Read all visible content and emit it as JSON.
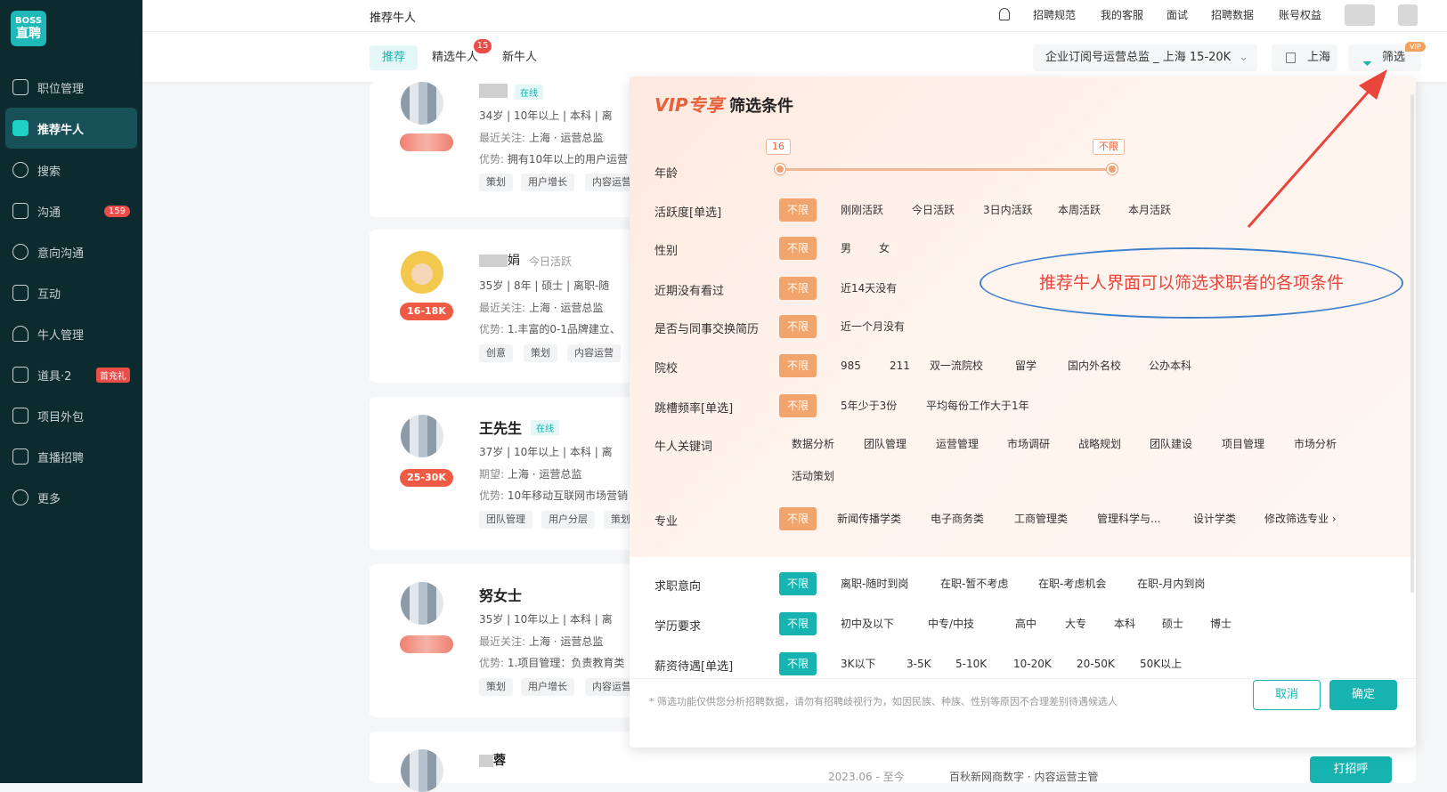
{
  "sidebar": {
    "logo_line1": "BOSS",
    "logo_line2": "直聘",
    "items": [
      {
        "label": "职位管理"
      },
      {
        "label": "推荐牛人"
      },
      {
        "label": "搜索"
      },
      {
        "label": "沟通",
        "badge": "159"
      },
      {
        "label": "意向沟通"
      },
      {
        "label": "互动"
      },
      {
        "label": "牛人管理"
      },
      {
        "label": "道具·2",
        "badge": "首充礼"
      },
      {
        "label": "项目外包"
      },
      {
        "label": "直播招聘"
      },
      {
        "label": "更多"
      }
    ]
  },
  "topbar": {
    "title": "推荐牛人",
    "menu": [
      "招聘规范",
      "我的客服",
      "面试",
      "招聘数据",
      "账号权益"
    ]
  },
  "subbar": {
    "tabs": [
      "推荐",
      "精选牛人",
      "新牛人"
    ],
    "tab_badge": "15",
    "job_select": "企业订阅号运营总监 _ 上海 15-20K",
    "city": "上海",
    "filter": "筛选",
    "vip": "VIP"
  },
  "cards": [
    {
      "active": "在线",
      "row1": [
        "34岁",
        "10年以上",
        "本科",
        "离"
      ],
      "row2_label": "最近关注:",
      "row2": [
        "上海",
        "运营总监"
      ],
      "row3_label": "优势:",
      "row3": "拥有10年以上的用户运营",
      "tags": [
        "策划",
        "用户增长",
        "内容运营"
      ]
    },
    {
      "name_tail": "娟",
      "active": "今日活跃",
      "salary": "16-18K",
      "row1": [
        "35岁",
        "8年",
        "硕士",
        "离职-随"
      ],
      "row2_label": "最近关注:",
      "row2": [
        "上海",
        "运营总监"
      ],
      "row3_label": "优势:",
      "row3": "1.丰富的0-1品牌建立、",
      "tags": [
        "创意",
        "策划",
        "内容运营"
      ]
    },
    {
      "name": "王先生",
      "active": "在线",
      "salary": "25-30K",
      "row1": [
        "37岁",
        "10年以上",
        "本科",
        "离"
      ],
      "row2_label": "期望:",
      "row2": [
        "上海",
        "运营总监"
      ],
      "row3_label": "优势:",
      "row3": "10年移动互联网市场营销",
      "tags": [
        "团队管理",
        "用户分层",
        "策划"
      ]
    },
    {
      "name": "努女士",
      "row1": [
        "35岁",
        "10年以上",
        "本科",
        "离"
      ],
      "row2_label": "最近关注:",
      "row2": [
        "上海",
        "运营总监"
      ],
      "row3_label": "优势:",
      "row3": "1.项目管理：负责教育类",
      "tags": [
        "策划",
        "用户增长",
        "内容运营"
      ]
    },
    {
      "name_tail": "蓉",
      "bottom_text": "2023.06 - 至今",
      "bottom_text2": "百秋新网商数字 · 内容运营主管",
      "greet": "打招呼"
    }
  ],
  "panel": {
    "vip_label": "VIP专享",
    "title": "筛选条件",
    "age_label": "年龄",
    "age_min": "16",
    "age_max": "不限",
    "rows": [
      {
        "label": "活跃度[单选]",
        "selected": "不限",
        "options": [
          "刚刚活跃",
          "今日活跃",
          "3日内活跃",
          "本周活跃",
          "本月活跃"
        ]
      },
      {
        "label": "性别",
        "selected": "不限",
        "options": [
          "男",
          "女"
        ]
      },
      {
        "label": "近期没有看过",
        "selected": "不限",
        "options": [
          "近14天没有"
        ]
      },
      {
        "label": "是否与同事交换简历",
        "selected": "不限",
        "options": [
          "近一个月没有"
        ]
      },
      {
        "label": "院校",
        "selected": "不限",
        "options": [
          "985",
          "211",
          "双一流院校",
          "留学",
          "国内外名校",
          "公办本科"
        ]
      },
      {
        "label": "跳槽频率[单选]",
        "selected": "不限",
        "options": [
          "5年少于3份",
          "平均每份工作大于1年"
        ]
      }
    ],
    "keyword_label": "牛人关键词",
    "keywords": [
      "数据分析",
      "团队管理",
      "运营管理",
      "市场调研",
      "战略规划",
      "团队建设",
      "项目管理",
      "市场分析",
      "活动策划"
    ],
    "major_label": "专业",
    "major_selected": "不限",
    "majors": [
      "新闻传播学类",
      "电子商务类",
      "工商管理类",
      "管理科学与...",
      "设计学类",
      "修改筛选专业 ›"
    ],
    "free_rows": [
      {
        "label": "求职意向",
        "selected": "不限",
        "options": [
          "离职-随时到岗",
          "在职-暂不考虑",
          "在职-考虑机会",
          "在职-月内到岗"
        ]
      },
      {
        "label": "学历要求",
        "selected": "不限",
        "options": [
          "初中及以下",
          "中专/中技",
          "高中",
          "大专",
          "本科",
          "硕士",
          "博士"
        ]
      },
      {
        "label": "薪资待遇[单选]",
        "selected": "不限",
        "options": [
          "3K以下",
          "3-5K",
          "5-10K",
          "10-20K",
          "20-50K",
          "50K以上"
        ]
      }
    ],
    "note": "* 筛选功能仅供您分析招聘数据，请勿有招聘歧视行为，如因民族、种族、性别等原因不合理差别待遇候选人",
    "cancel": "取消",
    "confirm": "确定"
  },
  "annotation": "推荐牛人界面可以筛选求职者的各项条件",
  "colors": {
    "brand": "#16b3b0",
    "vip": "#e7623b",
    "sidebar": "#0d2a2e",
    "arrow": "#e8463c"
  }
}
